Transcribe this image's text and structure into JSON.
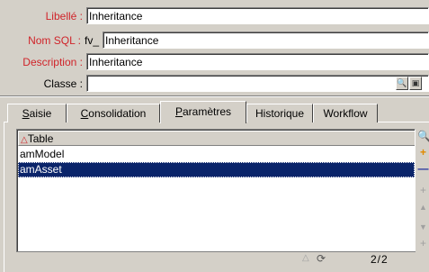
{
  "form": {
    "libelle_label": "Libellé :",
    "libelle_value": "Inheritance",
    "nomsql_label": "Nom SQL :",
    "nomsql_prefix": "fv_",
    "nomsql_value": "Inheritance",
    "description_label": "Description :",
    "description_value": "Inheritance",
    "classe_label": "Classe :",
    "classe_value": ""
  },
  "tabs": [
    {
      "label_ul": "S",
      "label_rest": "aisie"
    },
    {
      "label_ul": "C",
      "label_rest": "onsolidation"
    },
    {
      "label_ul": "P",
      "label_rest": "aramètres"
    },
    {
      "label_ul": "",
      "label_rest": "Historique"
    },
    {
      "label_ul": "",
      "label_rest": "Workflow"
    }
  ],
  "list": {
    "sort_indicator": "△",
    "header": "Table",
    "rows": [
      "amModel",
      "amAsset"
    ],
    "selected_index": 1
  },
  "status": {
    "page": "2/2"
  },
  "colors": {
    "required_label": "#d0242a",
    "selection": "#0a246a",
    "face": "#d4d0c8"
  }
}
